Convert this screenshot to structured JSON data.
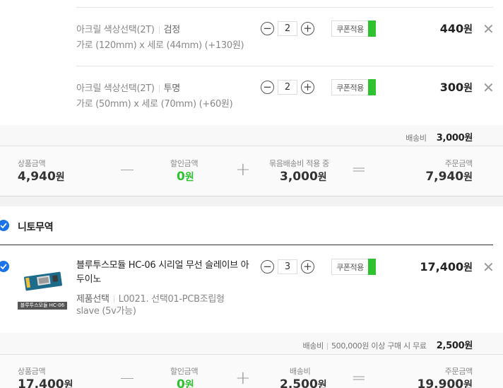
{
  "seller1": {
    "items": [
      {
        "opt_label": "아크릴 색상선택(2T)",
        "opt_value": "검정",
        "opt_sub": "가로 (120mm) x 세로 (44mm) (+130원)",
        "qty": "2",
        "coupon": "쿠폰적용",
        "price": "440",
        "won": "원"
      },
      {
        "opt_label": "아크릴 색상선택(2T)",
        "opt_value": "투명",
        "opt_sub": "가로 (50mm) x 세로 (70mm) (+60원)",
        "qty": "2",
        "coupon": "쿠폰적용",
        "price": "300",
        "won": "원"
      }
    ],
    "shipping_label": "배송비",
    "shipping_amount": "3,000원",
    "summary": {
      "product_label": "상품금액",
      "product_value": "4,940",
      "discount_label": "할인금액",
      "discount_value": "0",
      "shipping_label": "묶음배송비 적용 중",
      "shipping_value": "3,000",
      "order_label": "주문금액",
      "order_value": "7,940",
      "won": "원"
    }
  },
  "seller2": {
    "name": "니토무역",
    "item": {
      "title": "블루투스모듈 HC-06 시리얼 무선 슬레이브 아두이노",
      "thumb_caption": "블루투스모듈 HC-06",
      "opt_label": "제품선택",
      "opt_value": "L0021. 선택01-PCB조립형 slave (5v가능)",
      "qty": "3",
      "coupon": "쿠폰적용",
      "price": "17,400",
      "won": "원"
    },
    "shipping_label": "배송비",
    "shipping_note": "500,000원 이상 구매 시 무료",
    "shipping_amount": "2,500원",
    "summary": {
      "product_label": "상품금액",
      "product_value": "17,400",
      "discount_label": "할인금액",
      "discount_value": "0",
      "shipping_label": "배송비",
      "shipping_value": "2,500",
      "order_label": "주문금액",
      "order_value": "19,900",
      "won": "원"
    }
  },
  "icons": {
    "minus": "−",
    "plus": "+",
    "close": "✕",
    "op_minus": "—",
    "op_plus": "+",
    "op_equal": "="
  },
  "colors": {
    "accent_green": "#2fc12f",
    "check_blue": "#1a73e8"
  }
}
